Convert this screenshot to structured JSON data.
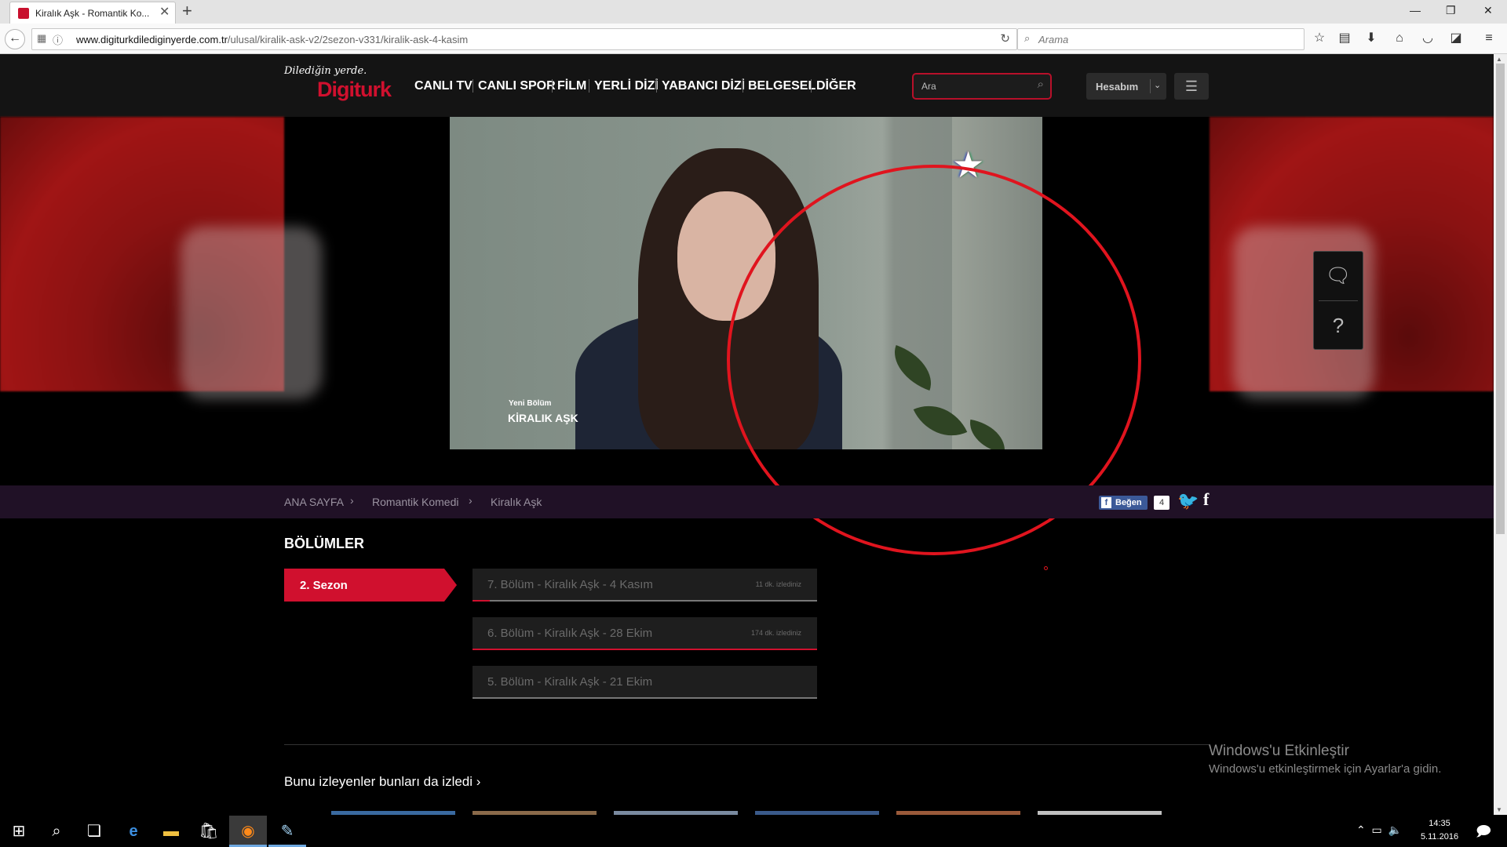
{
  "browser": {
    "tab_title": "Kiralık Aşk - Romantik Ko...",
    "tab_close": "✕",
    "new_tab": "+",
    "url_domain": "www.digiturkdilediginyerde.com.tr",
    "url_path": "/ulusal/kiralik-ask-v2/2sezon-v331/kiralik-ask-4-kasim",
    "search_placeholder": "Arama",
    "window_min": "—",
    "window_max": "❐",
    "window_close": "✕"
  },
  "site": {
    "logo_tagline": "Dilediğin yerde.",
    "logo_brand": "Digiturk",
    "nav": [
      "CANLI TV",
      "CANLI SPOR",
      "FİLM",
      "YERLİ DİZİ",
      "YABANCI DİZİ",
      "BELGESEL",
      "DİĞER"
    ],
    "search_placeholder": "Ara",
    "account_label": "Hesabım"
  },
  "video": {
    "overlay_small": "Yeni Bölüm",
    "overlay_title": "KİRALIK AŞK"
  },
  "breadcrumb": {
    "items": [
      "ANA SAYFA",
      "Romantik Komedi",
      "Kiralık Aşk"
    ],
    "separator": "›"
  },
  "social": {
    "like_label": "Beğen",
    "like_count": "4"
  },
  "episodes": {
    "heading": "BÖLÜMLER",
    "season_label": "2. Sezon",
    "items": [
      {
        "label": "7. Bölüm - Kiralık Aşk - 4 Kasım",
        "meta": "11 dk. izlediniz",
        "progress": 0.05
      },
      {
        "label": "6. Bölüm - Kiralık Aşk - 28 Ekim",
        "meta": "174 dk. izlediniz",
        "progress": 1.0
      },
      {
        "label": "5. Bölüm - Kiralık Aşk - 21 Ekim",
        "meta": "",
        "progress": 0
      }
    ]
  },
  "also_watched": {
    "heading": "Bunu izleyenler bunları da izledi",
    "chevron": "›"
  },
  "windows_activation": {
    "title": "Windows'u Etkinleştir",
    "subtitle": "Windows'u etkinleştirmek için Ayarlar'a gidin."
  },
  "taskbar": {
    "time": "14:35",
    "date": "5.11.2016"
  },
  "colors": {
    "brand_red": "#d0102e",
    "annotation_ring": "#e0141e",
    "crumb_bar": "#201126"
  }
}
